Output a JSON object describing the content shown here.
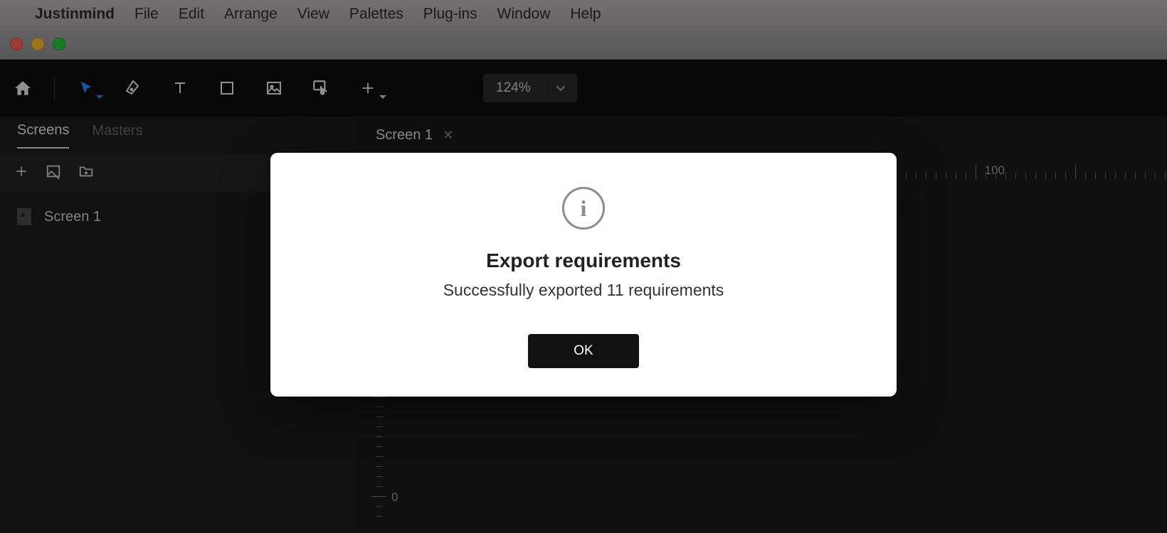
{
  "menubar": {
    "app_name": "Justinmind",
    "items": [
      "File",
      "Edit",
      "Arrange",
      "View",
      "Palettes",
      "Plug-ins",
      "Window",
      "Help"
    ]
  },
  "toolbar": {
    "zoom": "124%"
  },
  "sidebar": {
    "tabs": {
      "screens": "Screens",
      "masters": "Masters"
    },
    "screens": [
      {
        "name": "Screen 1"
      }
    ]
  },
  "canvas": {
    "tabs": [
      {
        "label": "Screen 1"
      }
    ],
    "ruler_h_label": "100",
    "ruler_v_zero": "0"
  },
  "dialog": {
    "title": "Export requirements",
    "message": "Successfully exported 11 requirements",
    "ok_label": "OK"
  }
}
